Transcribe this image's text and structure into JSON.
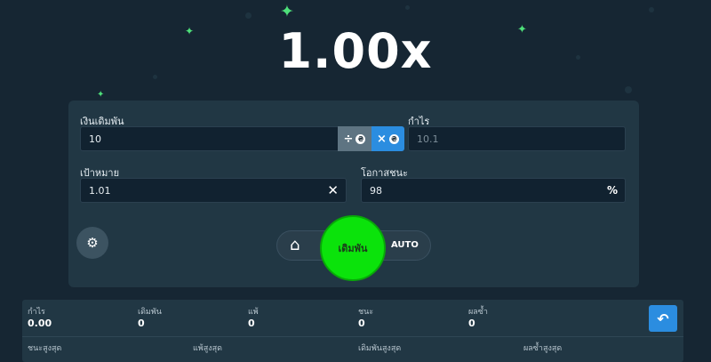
{
  "multiplier": "1.00x",
  "bet_amount": {
    "label": "เงินเดิมพัน",
    "value": "10",
    "divide_symbol": "÷",
    "multiply_symbol": "×",
    "coin_symbol": "₴"
  },
  "profit": {
    "label": "กำไร",
    "value": "10.1"
  },
  "target": {
    "label": "เป้าหมาย",
    "value": "1.01",
    "clear_symbol": "✕"
  },
  "win_chance": {
    "label": "โอกาสชนะ",
    "value": "98",
    "percent_symbol": "%"
  },
  "controls": {
    "settings_icon": "gear-icon",
    "home_icon": "home-icon",
    "bet_label": "เดิมพัน",
    "auto_label": "AUTO"
  },
  "stats": {
    "row1": [
      {
        "label": "กำไร",
        "value": "0.00"
      },
      {
        "label": "เดิมพัน",
        "value": "0"
      },
      {
        "label": "แพ้",
        "value": "0"
      },
      {
        "label": "ชนะ",
        "value": "0"
      },
      {
        "label": "ผลซ้ำ",
        "value": "0"
      }
    ],
    "row2": [
      {
        "label": "ชนะสูงสุด"
      },
      {
        "label": "แพ้สูงสุด"
      },
      {
        "label": "เดิมพันสูงสุด"
      },
      {
        "label": "ผลซ้ำสูงสุด"
      }
    ],
    "reset_icon": "undo-icon"
  },
  "colors": {
    "background": "#162633",
    "panel": "#213744",
    "accent_blue": "#2b8de0",
    "bet_green": "#0be30b",
    "star_green": "#4ee07a"
  }
}
